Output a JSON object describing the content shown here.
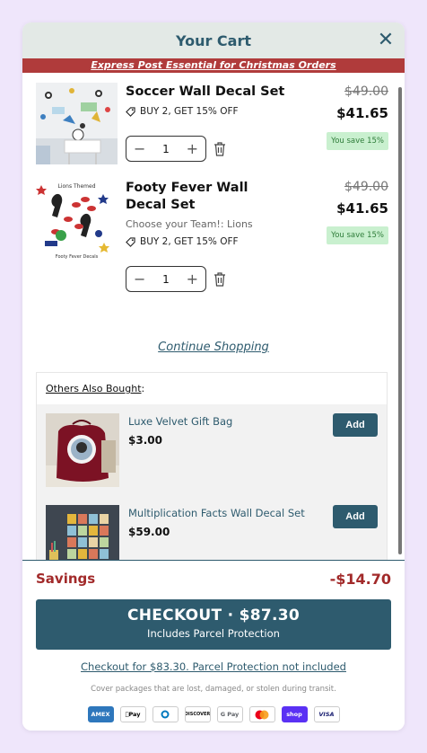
{
  "header": {
    "title": "Your Cart",
    "close_symbol": "✕"
  },
  "promo_banner": "Express Post Essential for Christmas Orders",
  "items": [
    {
      "title": "Soccer Wall Decal Set",
      "option": "",
      "promo": "BUY 2, GET 15% OFF",
      "price_old": "$49.00",
      "price_new": "$41.65",
      "savings_badge": "You save 15%",
      "quantity": "1"
    },
    {
      "title": "Footy Fever Wall Decal Set",
      "option": "Choose your Team!: Lions",
      "promo": "BUY 2, GET 15% OFF",
      "price_old": "$49.00",
      "price_new": "$41.65",
      "savings_badge": "You save 15%",
      "quantity": "1",
      "image_text_top": "Lions Themed",
      "image_text_bottom": "Footy Fever Decals"
    }
  ],
  "continue_shopping": "Continue Shopping",
  "upsell": {
    "heading": "Others Also Bought",
    "heading_suffix": ":",
    "items": [
      {
        "name": "Luxe Velvet Gift Bag",
        "price": "$3.00",
        "button": "Add"
      },
      {
        "name": "Multiplication Facts Wall Decal Set",
        "price": "$59.00",
        "button": "Add"
      }
    ]
  },
  "footer": {
    "savings_label": "Savings",
    "savings_value": "-$14.70",
    "checkout_main": "CHECKOUT · $87.30",
    "checkout_sub": "Includes Parcel Protection",
    "alt_checkout": "Checkout for $83.30. Parcel Protection not included",
    "protection_note": "Cover packages that are lost, damaged, or stolen during transit.",
    "payment_methods": [
      "AMEX",
      "Pay",
      "Diners",
      "DISCOVER",
      "G Pay",
      "Mastercard",
      "shop",
      "VISA"
    ]
  },
  "colors": {
    "accent": "#2e5b6e",
    "banner": "#b03b3b",
    "savings": "#a22a2a",
    "badge_bg": "#c9f0cf"
  }
}
